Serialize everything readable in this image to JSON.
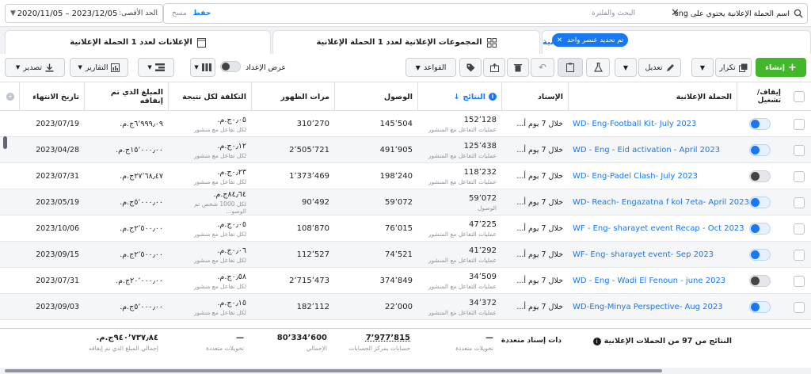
{
  "filter": {
    "date_label": "الحد الأقصى:",
    "date_range": "2020/11/05 – 2023/12/05",
    "filter_tag": "اسم الحملة الإعلانية يحتوي على eng",
    "search_placeholder": "البحث والفلترة",
    "save_label": "حفظ",
    "clear_label": "مسح"
  },
  "tabs": {
    "campaigns": "الحملات الإعلانية",
    "selected_chip": "تم تحديد عنصر واحد",
    "adsets": "المجموعات الإعلانية لعدد 1 الحملة الإعلانية",
    "ads": "الإعلانات لعدد 1 الحملة الإعلانية"
  },
  "toolbar": {
    "create": "إنشاء",
    "duplicate": "تكرار",
    "edit": "تعديل",
    "rules": "القواعد",
    "view_setup": "عرض الإعداد",
    "reports": "التقارير",
    "export": "تصدير"
  },
  "columns": {
    "toggle": "إيقاف/تشغيل",
    "campaign": "الحملة الإعلانية",
    "attribution": "الإسناد",
    "results": "النتائج",
    "reach": "الوصول",
    "impressions": "مرات الظهور",
    "cost_per_result": "التكلفة لكل نتيجة",
    "amount_spent": "المبلغ الذي تم إنفاقه",
    "end_date": "تاريخ الانتهاء"
  },
  "rows": [
    {
      "on": true,
      "campaign": "WD- Eng-Football Kit- July 2023",
      "attribution": "خلال 7 يوم أ...",
      "results": "152٬128",
      "result_type": "عمليات التفاعل مع المنشور",
      "reach": "145٬504",
      "impressions": "310٬270",
      "cpr": "٠٫٠٥ج.م.‏",
      "cpr_sub": "لكل تفاعل مع منشور",
      "spent": "٦٬٩٩٩٫٠٩ج.م.‏",
      "end": "2023/07/19"
    },
    {
      "on": true,
      "campaign": "WD - Eng - Eid activation - April 2023",
      "attribution": "خلال 7 يوم أ...",
      "results": "125٬438",
      "result_type": "عمليات التفاعل مع المنشور",
      "reach": "491٬905",
      "impressions": "2٬505٬721",
      "cpr": "٠٫١٢ج.م.‏",
      "cpr_sub": "لكل تفاعل مع منشور",
      "spent": "١٥٬٠٠٠٫٠٠ج.م.‏",
      "end": "2023/04/28"
    },
    {
      "on": false,
      "campaign": "WD- Eng-Padel Clash- July 2023",
      "attribution": "خلال 7 يوم أ...",
      "results": "118٬232",
      "result_type": "عمليات التفاعل مع المنشور",
      "reach": "198٬240",
      "impressions": "1٬373٬469",
      "cpr": "٠٫٢٣ج.م.‏",
      "cpr_sub": "لكل تفاعل مع منشور",
      "spent": "٢٧٬٦٨٫٤٧ج.م.‏",
      "end": "2023/07/31"
    },
    {
      "on": true,
      "campaign": "WD- Reach- Engazatna f kol 7eta- April 2023",
      "attribution": "خلال 7 يوم أ...",
      "results": "59٬072",
      "result_type": "الوصول",
      "reach": "59٬072",
      "impressions": "90٬492",
      "cpr": "٨٤٫٦٤ج.م.‏",
      "cpr_sub": "لكل 1000 شخص تم الوصو...",
      "spent": "٥٬٠٠٠٫٠٠ج.م.‏",
      "end": "2023/05/19"
    },
    {
      "on": true,
      "campaign": "WF - Eng- sharayet event Recap - Oct 2023",
      "attribution": "خلال 7 يوم أ...",
      "results": "47٬225",
      "result_type": "عمليات التفاعل مع المنشور",
      "reach": "76٬015",
      "impressions": "108٬870",
      "cpr": "٠٫٠٥ج.م.‏",
      "cpr_sub": "لكل تفاعل مع منشور",
      "spent": "٢٬٥٠٠٫٠٠ج.م.‏",
      "end": "2023/10/06"
    },
    {
      "on": true,
      "campaign": "WF- Eng- sharayet event- Sep 2023",
      "attribution": "خلال 7 يوم أ...",
      "results": "41٬292",
      "result_type": "عمليات التفاعل مع المنشور",
      "reach": "74٬521",
      "impressions": "112٬527",
      "cpr": "٠٫٠٦ج.م.‏",
      "cpr_sub": "لكل تفاعل مع منشور",
      "spent": "٢٬٥٠٠٫٠٠ج.م.‏",
      "end": "2023/09/15"
    },
    {
      "on": false,
      "campaign": "WD - Eng - Wadi El Fenoun - june 2023",
      "attribution": "خلال 7 يوم أ...",
      "results": "34٬509",
      "result_type": "عمليات التفاعل مع المنشور",
      "reach": "374٬849",
      "impressions": "2٬715٬473",
      "cpr": "٠٫٥٨ج.م.‏",
      "cpr_sub": "لكل تفاعل مع منشور",
      "spent": "٢٠٬٠٠٠٫٠٠ج.م.‏",
      "end": "2023/07/31"
    },
    {
      "on": true,
      "campaign": "WD-Eng-Minya Perspective- Aug 2023",
      "attribution": "خلال 7 يوم أ...",
      "results": "34٬372",
      "result_type": "عمليات التفاعل مع المنشور",
      "reach": "22٬000",
      "impressions": "182٬112",
      "cpr": "٠٫١٥ج.م.‏",
      "cpr_sub": "لكل تفاعل مع منشور",
      "spent": "٥٬٠٠٠٫٠٠ج.م.‏",
      "end": "2023/09/03"
    }
  ],
  "footer": {
    "summary": "النتائج من 97 من الحملات الإعلانية",
    "attribution": "دات إسناد متعددة",
    "results": "—",
    "results_sub": "تحويلات متعددة",
    "reach": "7٬977٬815",
    "reach_sub": "حسابات بمركز الحسابات",
    "impressions": "80٬334٬600",
    "impressions_sub": "الإجمالي",
    "cpr": "—",
    "cpr_sub": "تحويلات متعددة",
    "spent": "٩٤٠٬٧٣٧٫٨٤ج.م.‏",
    "spent_sub": "إجمالي المبلغ الذي تم إنفاقه"
  },
  "colors": {
    "accent": "#1877f2",
    "create": "#42b72a"
  }
}
